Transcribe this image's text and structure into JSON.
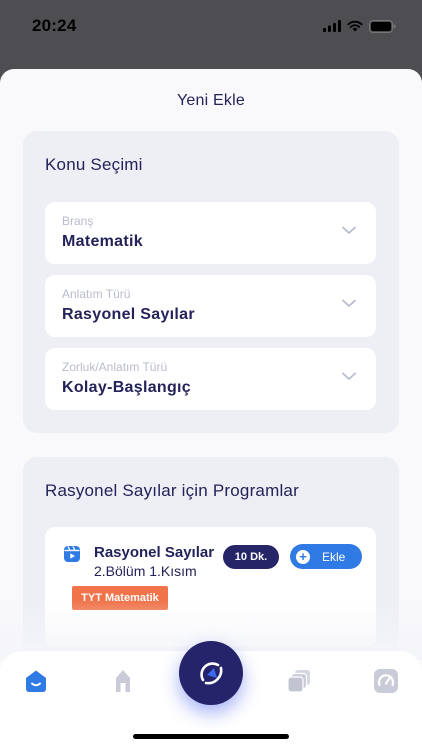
{
  "status_bar": {
    "time": "20:24"
  },
  "sheet": {
    "title": "Yeni Ekle"
  },
  "topic_card": {
    "heading": "Konu Seçimi",
    "selects": [
      {
        "label": "Branş",
        "value": "Matematik"
      },
      {
        "label": "Anlatım Türü",
        "value": "Rasyonel Sayılar"
      },
      {
        "label": "Zorluk/Anlatım Türü",
        "value": "Kolay-Başlangıç"
      }
    ]
  },
  "programs_card": {
    "heading": "Rasyonel Sayılar için Programlar",
    "items": [
      {
        "title": "Rasyonel Sayılar",
        "subtitle": "2.Bölüm 1.Kısım",
        "duration": "10 Dk.",
        "add_label": "Ekle",
        "tag": "TYT Matematik",
        "icon": "video-icon"
      }
    ]
  },
  "tab_bar": {
    "items": [
      "home-icon",
      "tower-icon",
      "center-action-icon",
      "stack-icon",
      "gauge-icon"
    ]
  },
  "colors": {
    "navy": "#23235a",
    "accent_blue": "#2f7ae5",
    "tag_orange": "#f0734a",
    "card_bg": "#eeeff5"
  }
}
